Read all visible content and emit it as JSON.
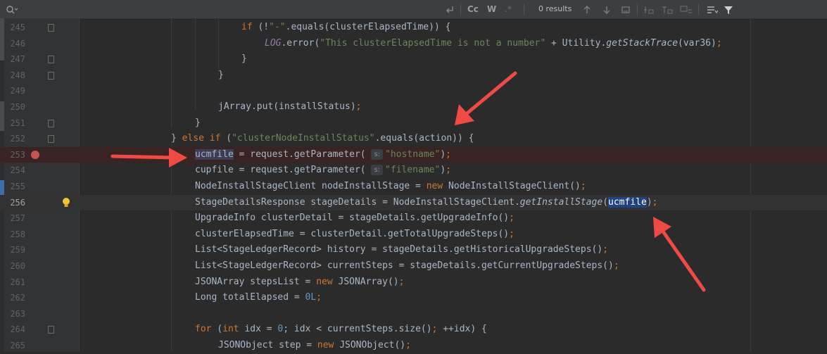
{
  "toolbar": {
    "search_value": "",
    "match_case_label": "Cc",
    "words_label": "W",
    "regex_label": ".*",
    "results_text": "0 results"
  },
  "lines": [
    {
      "num": "245",
      "segments": [
        {
          "t": "if",
          "c": "kw"
        },
        {
          "t": " (!",
          "c": ""
        },
        {
          "t": "\"-\"",
          "c": "str"
        },
        {
          "t": ".equals(clusterElapsedTime)) {",
          "c": ""
        }
      ]
    },
    {
      "num": "246",
      "segments": [
        {
          "t": "LOG",
          "c": "field"
        },
        {
          "t": ".error(",
          "c": ""
        },
        {
          "t": "\"This clusterElapsedTime is not a number\"",
          "c": "str"
        },
        {
          "t": " + Utility.",
          "c": ""
        },
        {
          "t": "getStackTrace",
          "c": "stat"
        },
        {
          "t": "(var36)",
          "c": ""
        },
        {
          "t": ";",
          "c": "kw"
        }
      ]
    },
    {
      "num": "247",
      "segments": [
        {
          "t": "}",
          "c": ""
        }
      ]
    },
    {
      "num": "248",
      "segments": [
        {
          "t": "}",
          "c": ""
        }
      ]
    },
    {
      "num": "249",
      "segments": []
    },
    {
      "num": "250",
      "segments": [
        {
          "t": "jArray.put(installStatus)",
          "c": ""
        },
        {
          "t": ";",
          "c": "kw"
        }
      ]
    },
    {
      "num": "251",
      "segments": [
        {
          "t": "}",
          "c": ""
        }
      ]
    },
    {
      "num": "252",
      "segments": [
        {
          "t": "} ",
          "c": ""
        },
        {
          "t": "else if",
          "c": "kw"
        },
        {
          "t": " (",
          "c": ""
        },
        {
          "t": "\"clusterNodeInstallStatus\"",
          "c": "str"
        },
        {
          "t": ".equals(action)) {",
          "c": ""
        }
      ]
    },
    {
      "num": "253",
      "segments": [
        {
          "t": "ucmfile",
          "c": "wordhl"
        },
        {
          "t": " = request.getParameter( ",
          "c": ""
        },
        {
          "t": "s:",
          "c": "hint"
        },
        {
          "t": "\"hostname\"",
          "c": "str"
        },
        {
          "t": ")",
          "c": ""
        },
        {
          "t": ";",
          "c": "kw"
        }
      ]
    },
    {
      "num": "254",
      "segments": [
        {
          "t": "cupfile = request.getParameter( ",
          "c": ""
        },
        {
          "t": "s:",
          "c": "hint"
        },
        {
          "t": "\"filename\"",
          "c": "str"
        },
        {
          "t": ")",
          "c": ""
        },
        {
          "t": ";",
          "c": "kw"
        }
      ]
    },
    {
      "num": "255",
      "segments": [
        {
          "t": "NodeInstallStageClient nodeInstallStage = ",
          "c": ""
        },
        {
          "t": "new",
          "c": "kw"
        },
        {
          "t": " NodeInstallStageClient()",
          "c": ""
        },
        {
          "t": ";",
          "c": "kw"
        }
      ]
    },
    {
      "num": "256",
      "segments": [
        {
          "t": "StageDetailsResponse stageDetails = NodeInstallStageClient.",
          "c": ""
        },
        {
          "t": "getInstallStage",
          "c": "stat"
        },
        {
          "t": "(",
          "c": ""
        },
        {
          "t": "ucmfile",
          "c": "hl"
        },
        {
          "t": ")",
          "c": ""
        },
        {
          "t": ";",
          "c": "kw"
        }
      ]
    },
    {
      "num": "257",
      "segments": [
        {
          "t": "UpgradeInfo clusterDetail = stageDetails.getUpgradeInfo()",
          "c": ""
        },
        {
          "t": ";",
          "c": "kw"
        }
      ]
    },
    {
      "num": "258",
      "segments": [
        {
          "t": "clusterElapsedTime = clusterDetail.getTotalUpgradeSteps()",
          "c": ""
        },
        {
          "t": ";",
          "c": "kw"
        }
      ]
    },
    {
      "num": "259",
      "segments": [
        {
          "t": "List<StageLedgerRecord> history = stageDetails.getHistoricalUpgradeSteps()",
          "c": ""
        },
        {
          "t": ";",
          "c": "kw"
        }
      ]
    },
    {
      "num": "260",
      "segments": [
        {
          "t": "List<StageLedgerRecord> currentSteps = stageDetails.getCurrentUpgradeSteps()",
          "c": ""
        },
        {
          "t": ";",
          "c": "kw"
        }
      ]
    },
    {
      "num": "261",
      "segments": [
        {
          "t": "JSONArray stepsList = ",
          "c": ""
        },
        {
          "t": "new",
          "c": "kw"
        },
        {
          "t": " JSONArray()",
          "c": ""
        },
        {
          "t": ";",
          "c": "kw"
        }
      ]
    },
    {
      "num": "262",
      "segments": [
        {
          "t": "Long totalElapsed = ",
          "c": ""
        },
        {
          "t": "0L",
          "c": "num"
        },
        {
          "t": ";",
          "c": "kw"
        }
      ]
    },
    {
      "num": "263",
      "segments": []
    },
    {
      "num": "264",
      "segments": [
        {
          "t": "for",
          "c": "kw"
        },
        {
          "t": " (",
          "c": ""
        },
        {
          "t": "int",
          "c": "kw"
        },
        {
          "t": " idx = ",
          "c": ""
        },
        {
          "t": "0",
          "c": "num"
        },
        {
          "t": "; idx < currentSteps.size()",
          "c": ""
        },
        {
          "t": ";",
          "c": "kw"
        },
        {
          "t": " ++idx) {",
          "c": ""
        }
      ]
    },
    {
      "num": "265",
      "segments": [
        {
          "t": "JSONObject step = ",
          "c": ""
        },
        {
          "t": "new",
          "c": "kw"
        },
        {
          "t": " JSONObject()",
          "c": ""
        },
        {
          "t": ";",
          "c": "kw"
        }
      ]
    }
  ]
}
